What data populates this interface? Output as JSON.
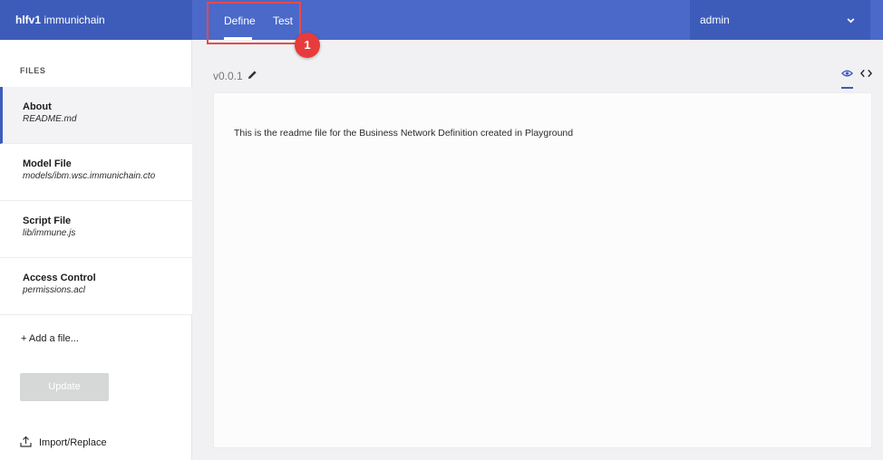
{
  "app": {
    "brand_bold": "hlfv1",
    "brand_name": "immunichain"
  },
  "tabs": [
    {
      "label": "Define",
      "active": true
    },
    {
      "label": "Test",
      "active": false
    }
  ],
  "user": {
    "name": "admin"
  },
  "annotation": {
    "badge": "1",
    "color": "#e83b3b"
  },
  "sidebar": {
    "files_title": "FILES",
    "items": [
      {
        "title": "About",
        "path": "README.md",
        "active": true
      },
      {
        "title": "Model File",
        "path": "models/ibm.wsc.immunichain.cto",
        "active": false
      },
      {
        "title": "Script File",
        "path": "lib/immune.js",
        "active": false
      },
      {
        "title": "Access Control",
        "path": "permissions.acl",
        "active": false
      }
    ],
    "add_file": "+ Add a file...",
    "update_button": "Update",
    "import_label": "Import/Replace"
  },
  "main": {
    "version": "v0.0.1",
    "readme_text": "This is the readme file for the Business Network Definition created in Playground"
  },
  "icons": {
    "pencil": "pencil-icon",
    "eye": "eye-icon",
    "code": "code-icon",
    "chevron": "chevron-down-icon",
    "upload": "upload-icon"
  },
  "colors": {
    "header": "#4a69c9",
    "header_dark": "#3d5cba",
    "accent": "#3d5cba",
    "update_disabled": "#d5d8d7"
  }
}
